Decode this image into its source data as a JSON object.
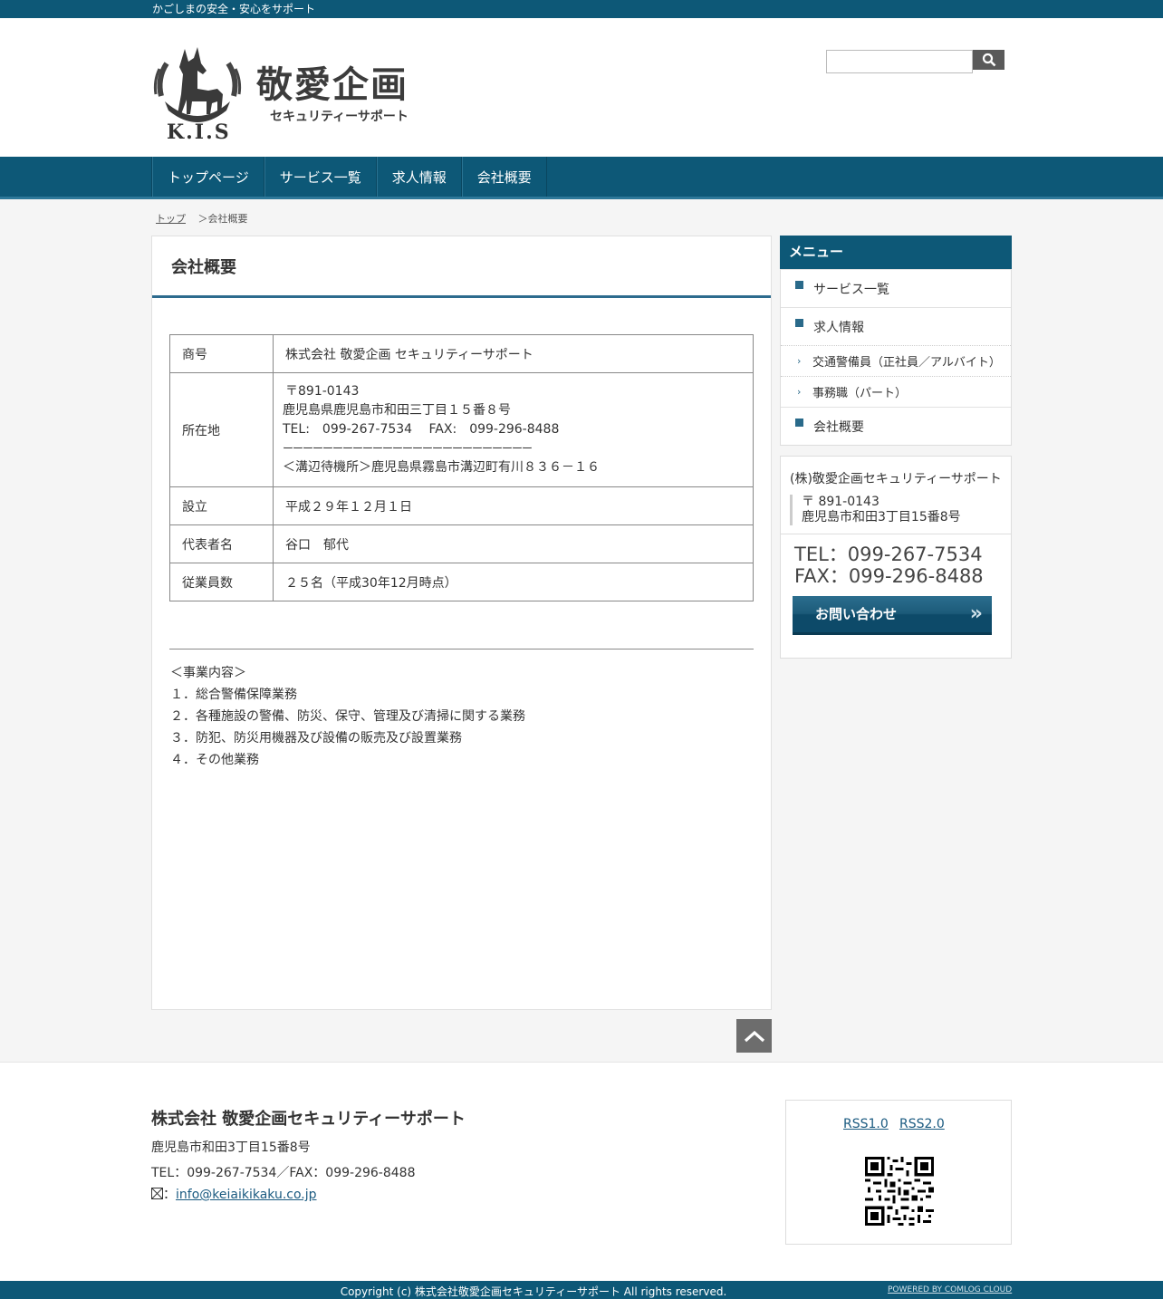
{
  "topbar": {
    "tagline": "かごしまの安全・安心をサポート"
  },
  "header": {
    "logo_brand": "敬愛企画",
    "logo_sub": "セキュリティーサポート",
    "logo_kis": "K.I.S",
    "search_placeholder": ""
  },
  "nav": {
    "items": [
      "トップページ",
      "サービス一覧",
      "求人情報",
      "会社概要"
    ]
  },
  "breadcrumb": {
    "home": "トップ",
    "current": "＞会社概要"
  },
  "main": {
    "title": "会社概要",
    "rows": [
      {
        "label": "商号",
        "value": "株式会社 敬愛企画 セキュリティーサポート"
      },
      {
        "label": "所在地",
        "lines": [
          "〒891-0143",
          "鹿児島県鹿児島市和田三丁目１５番８号",
          "TEL:　099-267-7534　 FAX:　099-296-8488",
          "ーーーーーーーーーーーーーーーーーーーーーーーーー",
          "＜溝辺待機所＞鹿児島県霧島市溝辺町有川８３６－１６"
        ]
      },
      {
        "label": "設立",
        "value": "平成２９年１２月１日"
      },
      {
        "label": "代表者名",
        "value": "谷口　郁代"
      },
      {
        "label": "従業員数",
        "value": "２５名（平成30年12月時点）"
      }
    ],
    "business": [
      "＜事業内容＞",
      "１．総合警備保障業務",
      "２．各種施設の警備、防災、保守、管理及び清掃に関する業務",
      "３．防犯、防災用機器及び設備の販売及び設置業務",
      "４．その他業務"
    ]
  },
  "sidebar": {
    "menu_title": "メニュー",
    "items": [
      {
        "label": "サービス一覧",
        "type": "main"
      },
      {
        "label": "求人情報",
        "type": "main"
      },
      {
        "label": "交通警備員（正社員／アルバイト）",
        "type": "sub"
      },
      {
        "label": "事務職（パート）",
        "type": "sub"
      },
      {
        "label": "会社概要",
        "type": "main"
      }
    ],
    "contact": {
      "name": "(株)敬愛企画セキュリティーサポート",
      "zip": "〒 891-0143",
      "address": "鹿児島市和田3丁目15番8号",
      "tel": "TEL：099-267-7534",
      "fax": "FAX：099-296-8488",
      "button": "お問い合わせ"
    }
  },
  "footer": {
    "company": "株式会社 敬愛企画セキュリティーサポート",
    "address": "鹿児島市和田3丁目15番8号",
    "telfax": "TEL：099-267-7534／FAX：099-296-8488",
    "mail_prefix": "：",
    "email": "info@keiaikikaku.co.jp",
    "rss1": "RSS1.0",
    "rss2": "RSS2.0",
    "copyright": "Copyright (c) 株式会社敬愛企画セキュリティーサポート All rights  reserved.",
    "powered": "POWERED BY  COMLOG CLOUD"
  },
  "colors": {
    "primary": "#0d5877",
    "accent_line": "#2d6b8e",
    "background": "#f5f5f5"
  }
}
